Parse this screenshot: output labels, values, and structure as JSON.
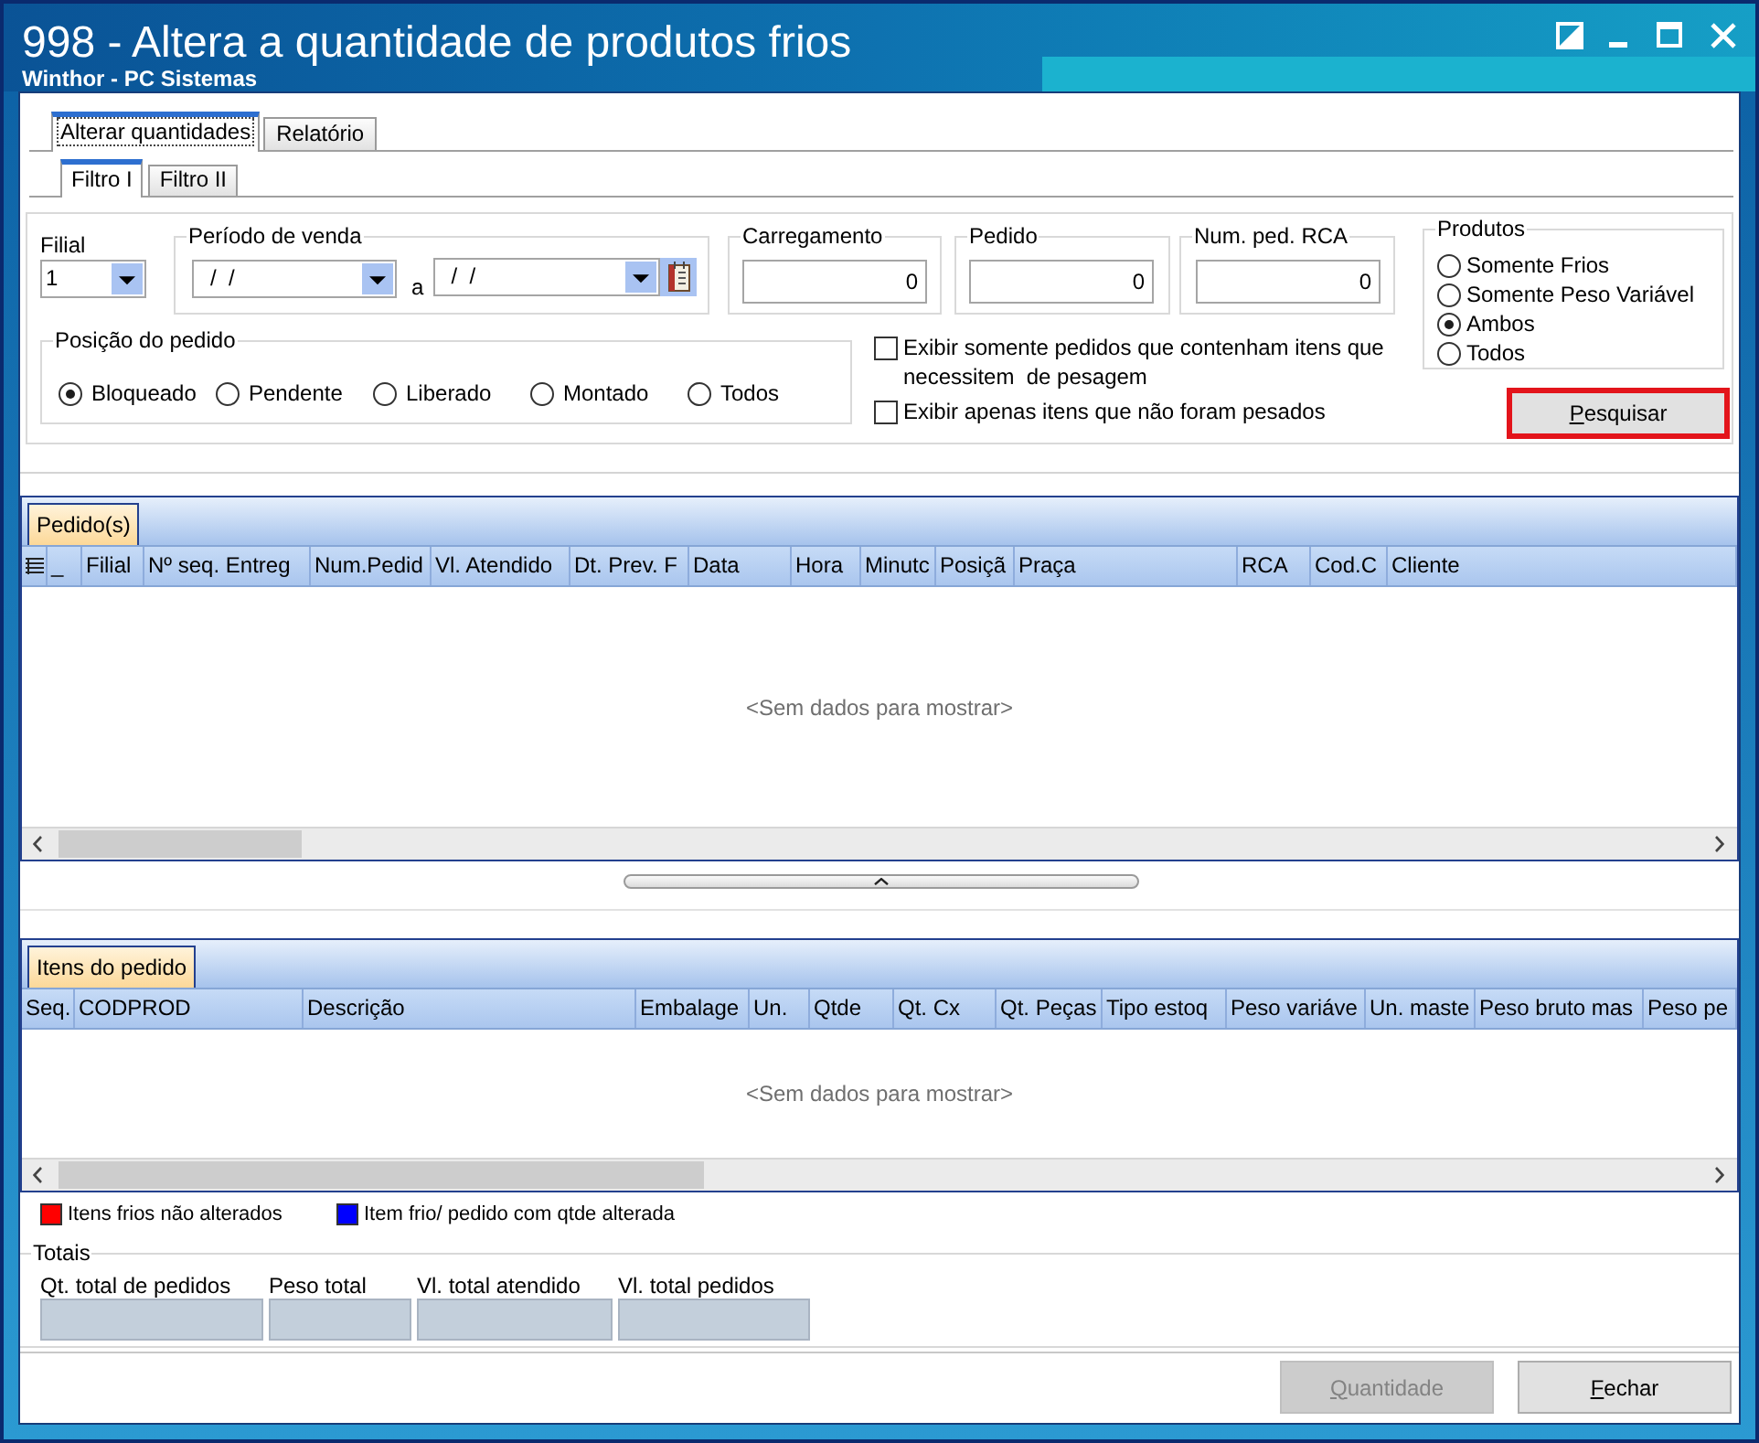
{
  "window": {
    "title": "998 - Altera a quantidade de produtos frios",
    "subtitle": "Winthor - PC Sistemas"
  },
  "tabs": [
    {
      "label": "Alterar quantidades",
      "selected": true
    },
    {
      "label": "Relatório",
      "selected": false
    }
  ],
  "subtabs": [
    {
      "label": "Filtro I",
      "selected": true
    },
    {
      "label": "Filtro II",
      "selected": false
    }
  ],
  "filters": {
    "filial": {
      "label": "Filial",
      "value": "1"
    },
    "periodo": {
      "label": "Período de venda",
      "from": "/  /",
      "separator": "a",
      "to": "/  /"
    },
    "numbers": [
      {
        "label": "Carregamento",
        "value": "0"
      },
      {
        "label": "Pedido",
        "value": "0"
      },
      {
        "label": "Num. ped. RCA",
        "value": "0"
      }
    ],
    "posicao": {
      "label": "Posição do pedido",
      "options": [
        {
          "label": "Bloqueado",
          "selected": true
        },
        {
          "label": "Pendente",
          "selected": false
        },
        {
          "label": "Liberado",
          "selected": false
        },
        {
          "label": "Montado",
          "selected": false
        },
        {
          "label": "Todos",
          "selected": false
        }
      ]
    },
    "checks": [
      {
        "label": "Exibir somente pedidos que contenham itens que necessitem  de pesagem",
        "checked": false
      },
      {
        "label": "Exibir apenas itens que não foram pesados",
        "checked": false
      }
    ],
    "produtos": {
      "label": "Produtos",
      "options": [
        {
          "label": "Somente Frios",
          "selected": false
        },
        {
          "label": "Somente Peso Variável",
          "selected": false
        },
        {
          "label": "Ambos",
          "selected": true
        },
        {
          "label": "Todos",
          "selected": false
        }
      ]
    },
    "search_button": {
      "label": "Pesquisar",
      "mnemonic": true,
      "highlighted": true
    }
  },
  "orders_grid": {
    "tab": "Pedido(s)",
    "columns": [
      "_",
      "Filial",
      "Nº seq. Entreg",
      "Num.Pedid",
      "Vl. Atendido",
      "Dt. Prev. F",
      "Data",
      "Hora",
      "Minutc",
      "Posiçã",
      "Praça",
      "RCA",
      "Cod.C",
      "Cliente"
    ],
    "empty_text": "<Sem dados para mostrar>"
  },
  "items_grid": {
    "tab": "Itens do pedido",
    "columns": [
      "Seq.",
      "CODPROD",
      "Descrição",
      "Embalage",
      "Un.",
      "Qtde",
      "Qt. Cx",
      "Qt. Peças",
      "Tipo estoq",
      "Peso variáve",
      "Un. maste",
      "Peso bruto mas",
      "Peso pe"
    ],
    "empty_text": "<Sem dados para mostrar>"
  },
  "legend": [
    {
      "label": "Itens frios não alterados",
      "color": "#ff0000"
    },
    {
      "label": "Item frio/ pedido com qtde alterada",
      "color": "#0000ff"
    }
  ],
  "totals": {
    "title": "Totais",
    "fields": [
      "Qt. total de pedidos",
      "Peso total",
      "Vl. total atendido",
      "Vl. total pedidos"
    ]
  },
  "buttons": [
    {
      "label": "Quantidade",
      "disabled": true,
      "mnemonic": true
    },
    {
      "label": "Fechar",
      "disabled": false,
      "mnemonic": true
    }
  ]
}
